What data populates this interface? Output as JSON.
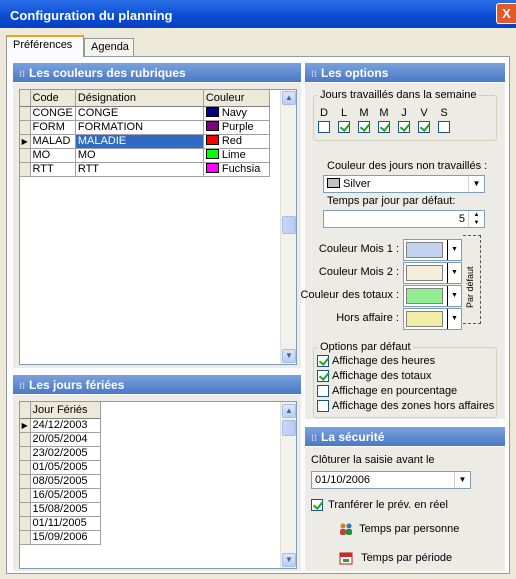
{
  "window": {
    "title": "Configuration du planning",
    "close_glyph": "X"
  },
  "tabs": [
    {
      "label": "Préférences",
      "active": true
    },
    {
      "label": "Agenda",
      "active": false
    }
  ],
  "rubriques": {
    "title": "Les couleurs des rubriques",
    "columns": [
      "Code",
      "Désignation",
      "Couleur"
    ],
    "rows": [
      {
        "code": "CONGE",
        "designation": "CONGE",
        "couleur": "Navy",
        "hex": "#000080"
      },
      {
        "code": "FORM",
        "designation": "FORMATION",
        "couleur": "Purple",
        "hex": "#800080"
      },
      {
        "code": "MALAD",
        "designation": "MALADIE",
        "couleur": "Red",
        "hex": "#ff0000",
        "selected": true
      },
      {
        "code": "MO",
        "designation": "MO",
        "couleur": "Lime",
        "hex": "#00ff00"
      },
      {
        "code": "RTT",
        "designation": "RTT",
        "couleur": "Fuchsia",
        "hex": "#ff00ff"
      }
    ]
  },
  "feries": {
    "title": "Les jours fériées",
    "column": "Jour Fériés",
    "dates": [
      "24/12/2003",
      "20/05/2004",
      "23/02/2005",
      "01/05/2005",
      "08/05/2005",
      "16/05/2005",
      "15/08/2005",
      "01/11/2005",
      "15/09/2006"
    ]
  },
  "options": {
    "title": "Les options",
    "jours_group": "Jours travaillés dans la semaine",
    "days": [
      {
        "label": "D",
        "checked": false
      },
      {
        "label": "L",
        "checked": true
      },
      {
        "label": "M",
        "checked": true
      },
      {
        "label": "M",
        "checked": true
      },
      {
        "label": "J",
        "checked": true
      },
      {
        "label": "V",
        "checked": true
      },
      {
        "label": "S",
        "checked": false
      }
    ],
    "non_travailles_label": "Couleur des jours non travaillés :",
    "non_travailles_value": "Silver",
    "non_travailles_hex": "#c0c0c0",
    "temps_label": "Temps par jour par défaut:",
    "temps_value": "5",
    "colors": [
      {
        "label": "Couleur Mois 1 :",
        "hex": "#c3d3ee"
      },
      {
        "label": "Couleur Mois 2 :",
        "hex": "#f6eedd"
      },
      {
        "label": "Couleur des totaux :",
        "hex": "#90ee90"
      },
      {
        "label": "Hors affaire :",
        "hex": "#f2eea6"
      }
    ],
    "par_defaut": "Par défaut",
    "defaut_group": "Options par défaut",
    "defaut_options": [
      {
        "label": "Affichage des heures",
        "checked": true
      },
      {
        "label": "Affichage des totaux",
        "checked": true
      },
      {
        "label": "Affichage en pourcentage",
        "checked": false
      },
      {
        "label": "Affichage des zones hors affaires",
        "checked": false
      }
    ]
  },
  "securite": {
    "title": "La sécurité",
    "cloturer_label": "Clôturer la saisie avant le",
    "cloturer_value": "01/10/2006",
    "transferer_label": "Tranférer le prév. en réel",
    "transferer_checked": true,
    "btn_personne": "Temps par personne",
    "btn_periode": "Temps par période"
  }
}
